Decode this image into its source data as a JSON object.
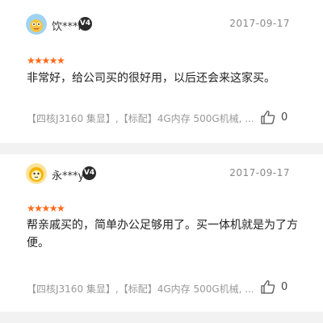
{
  "reviews": [
    {
      "username": "饮***i",
      "badge": "V4",
      "date": "2017-09-17",
      "stars": "★★★★★",
      "content": "非常好，给公司买的很好用，以后还会来这家买。",
      "specs": "【四核J3160 集显】,【标配】4G内存 500G机械, ...",
      "likes": "0"
    },
    {
      "username": "永***y",
      "badge": "V4",
      "date": "2017-09-17",
      "stars": "★★★★★",
      "content": "帮亲戚买的，简单办公足够用了。买一体机就是为了方便。",
      "specs": "【四核J3160 集显】,【标配】4G内存 500G机械, ...",
      "likes": "0"
    }
  ],
  "colors": {
    "star": "#ff6a1a",
    "separator": "#f2f2f2",
    "muted": "#999999"
  },
  "icons": {
    "like": "thumbs-up-icon",
    "badge": "vip-level-badge-icon"
  }
}
